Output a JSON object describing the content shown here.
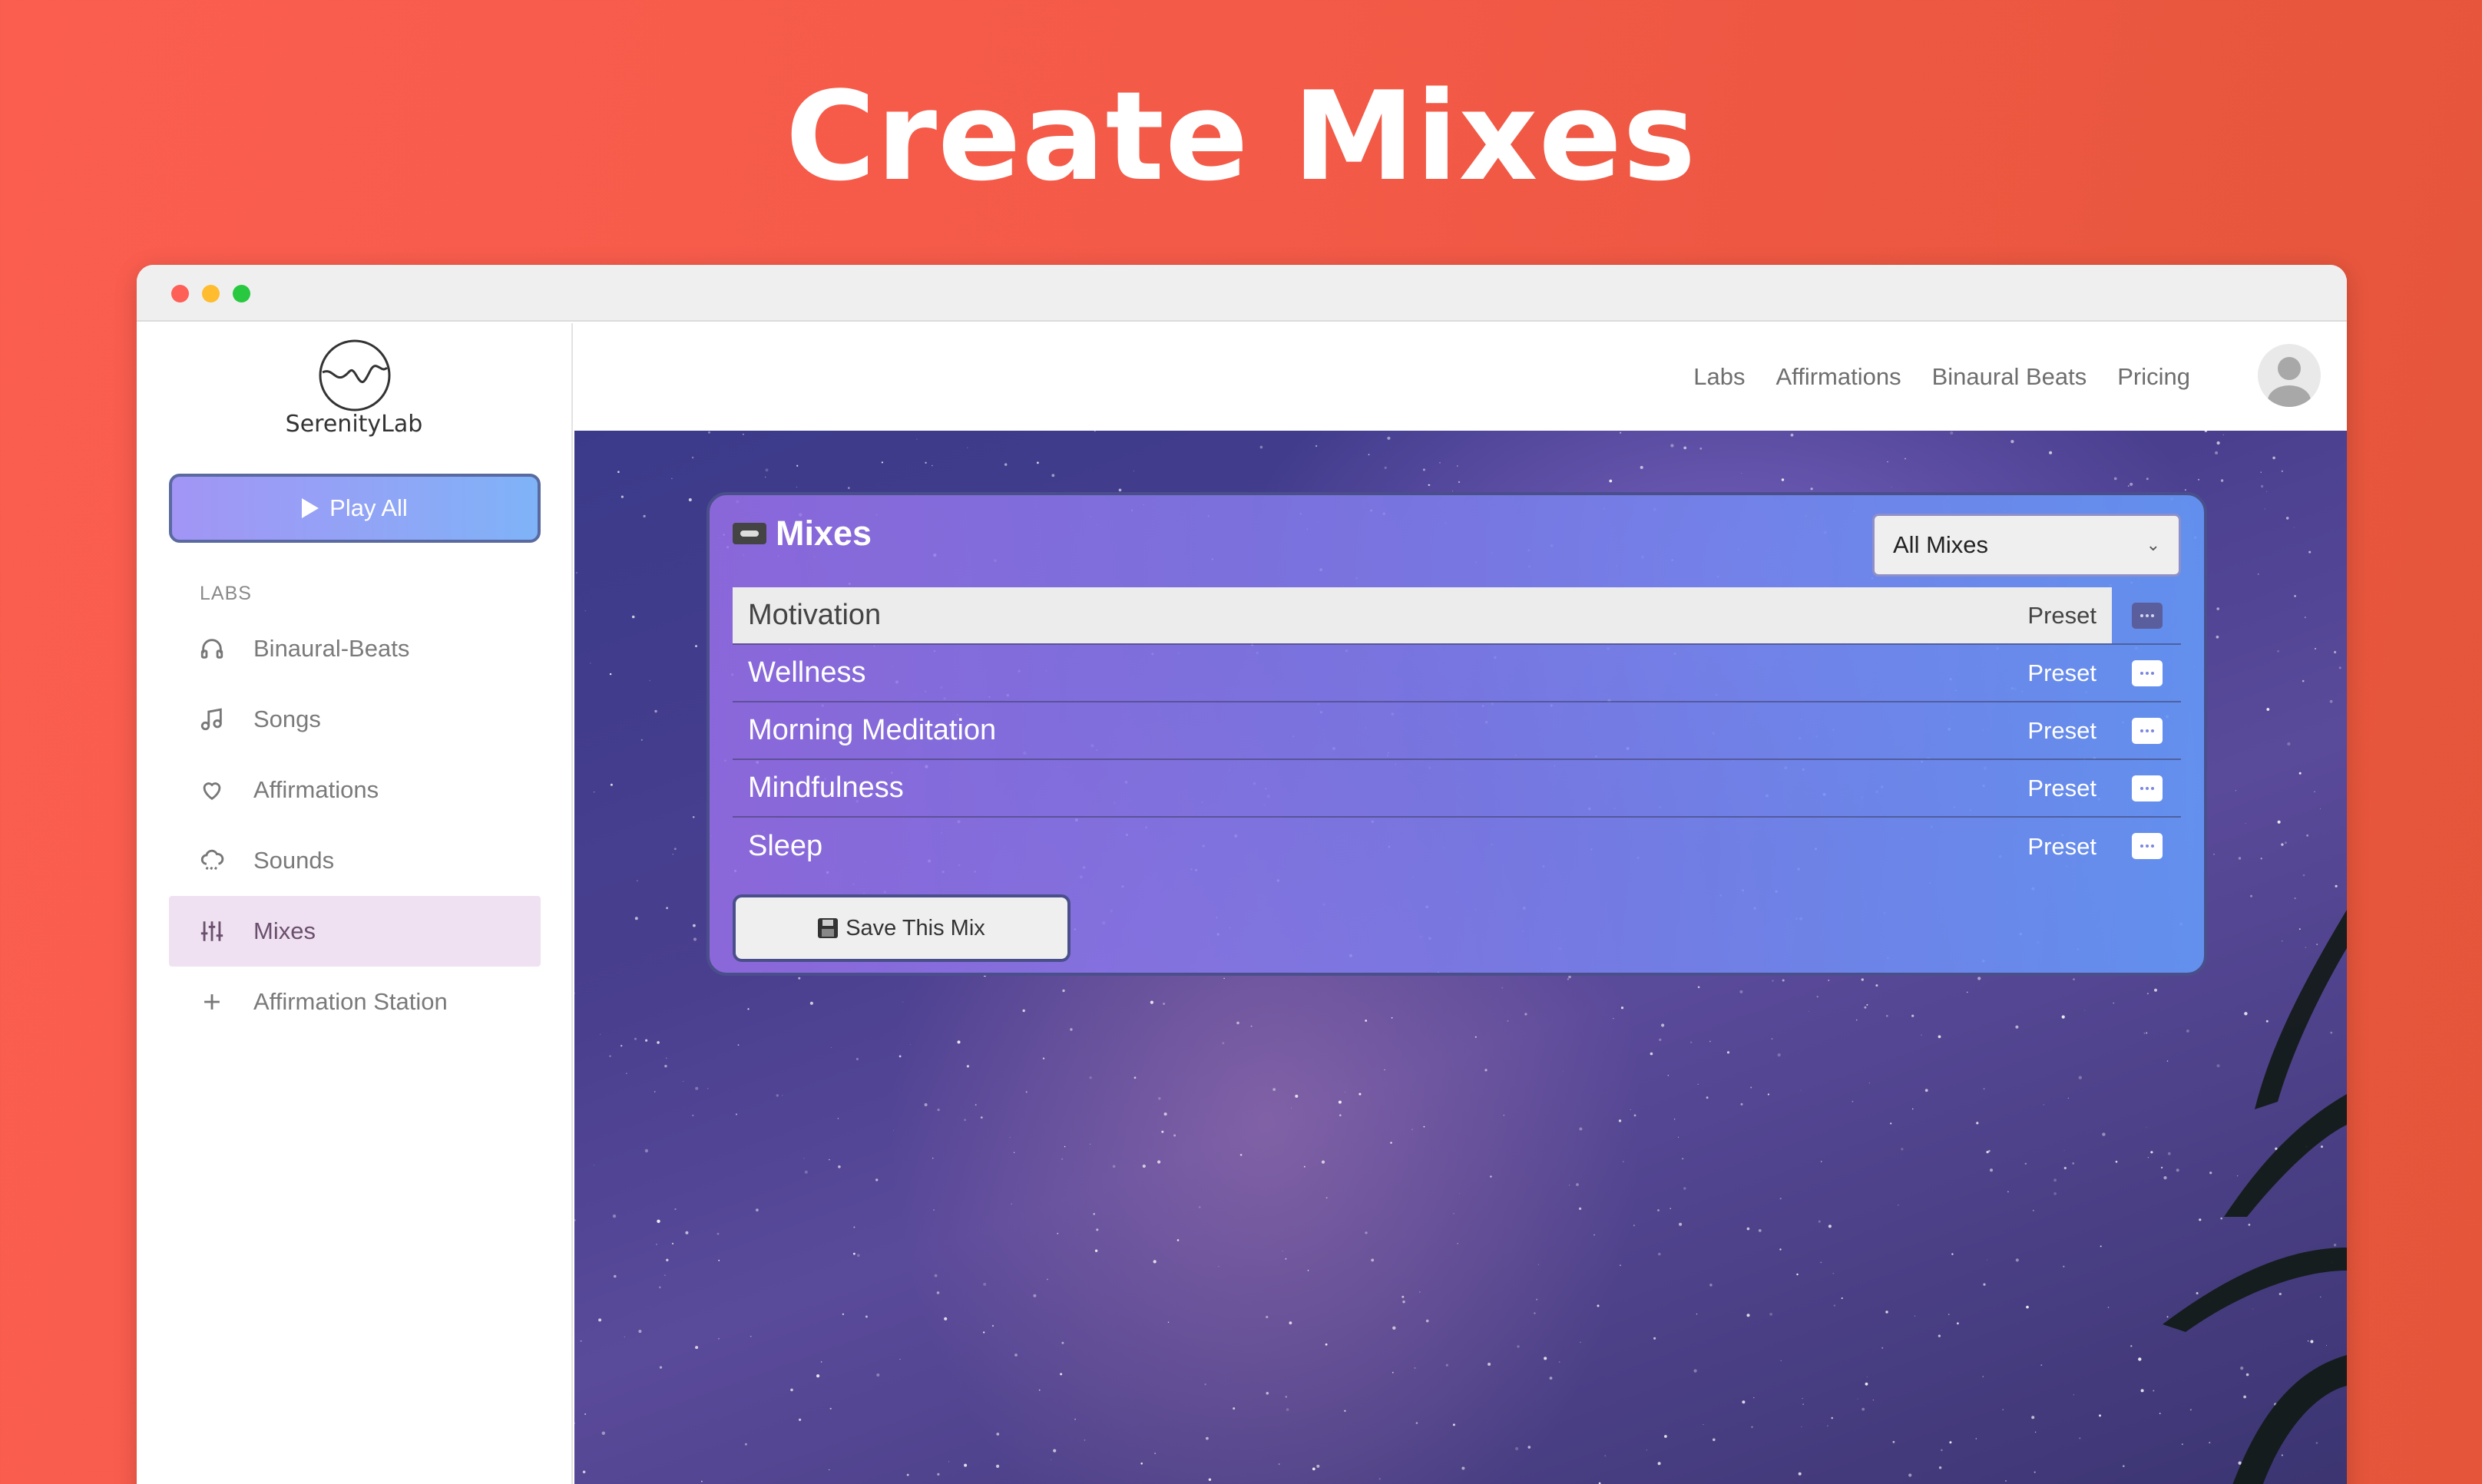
{
  "hero": {
    "title": "Create Mixes"
  },
  "app": {
    "brand": "SerenityLab"
  },
  "sidebar": {
    "play_all_label": "Play All",
    "section_label": "LABS",
    "items": [
      {
        "label": "Binaural-Beats",
        "icon": "headphones-icon"
      },
      {
        "label": "Songs",
        "icon": "music-note-icon"
      },
      {
        "label": "Affirmations",
        "icon": "heart-icon"
      },
      {
        "label": "Sounds",
        "icon": "rain-cloud-icon"
      },
      {
        "label": "Mixes",
        "icon": "sliders-icon",
        "active": true
      },
      {
        "label": "Affirmation Station",
        "icon": "plus-icon"
      }
    ]
  },
  "topnav": {
    "links": [
      "Labs",
      "Affirmations",
      "Binaural Beats",
      "Pricing"
    ]
  },
  "panel": {
    "title": "Mixes",
    "filter_value": "All Mixes",
    "mixes": [
      {
        "name": "Motivation",
        "tag": "Preset",
        "selected": true
      },
      {
        "name": "Wellness",
        "tag": "Preset"
      },
      {
        "name": "Morning Meditation",
        "tag": "Preset"
      },
      {
        "name": "Mindfulness",
        "tag": "Preset"
      },
      {
        "name": "Sleep",
        "tag": "Preset"
      }
    ],
    "save_label": "Save This Mix"
  },
  "colors": {
    "background": "#f45a48",
    "accent_gradient_start": "#a295f5",
    "accent_gradient_end": "#7fb3f8",
    "active_nav": "#efe1f1"
  }
}
